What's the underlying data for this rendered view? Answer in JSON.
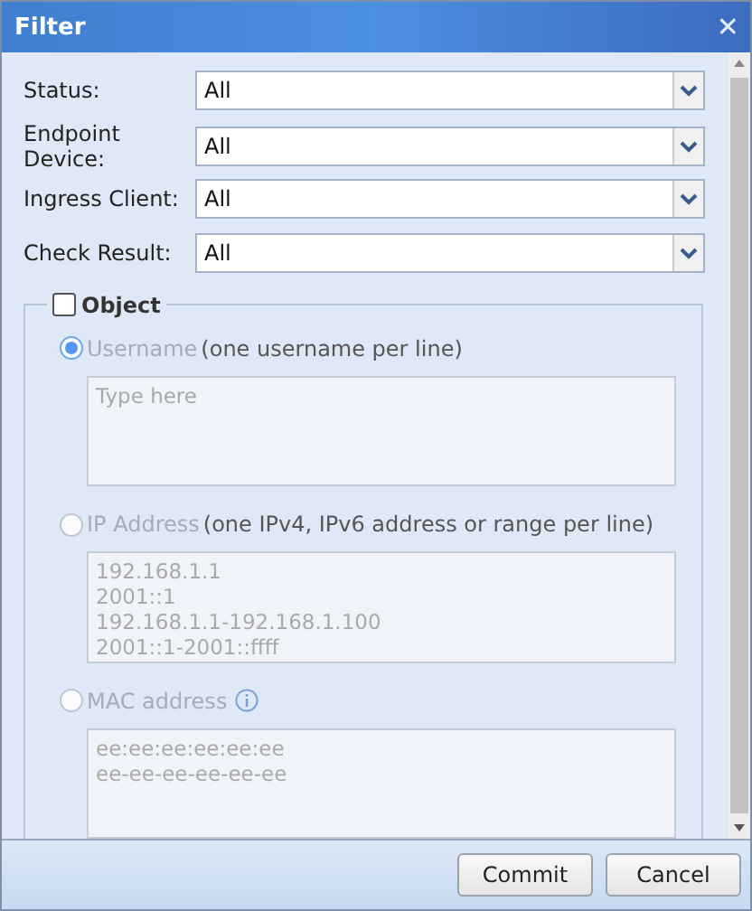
{
  "window": {
    "title": "Filter",
    "close": "✕"
  },
  "filters": [
    {
      "label": "Status:",
      "value": "All"
    },
    {
      "label": "Endpoint Device:",
      "value": "All"
    },
    {
      "label": "Ingress Client:",
      "value": "All"
    },
    {
      "label": "Check Result:",
      "value": "All"
    }
  ],
  "object": {
    "label": "Object",
    "checked": false,
    "options": [
      {
        "label": "Username",
        "hint": "(one username per line)",
        "selected": true,
        "disabled": true,
        "placeholder": "Type here"
      },
      {
        "label": "IP Address",
        "hint": "(one IPv4, IPv6 address or range per line)",
        "selected": false,
        "disabled": true,
        "placeholder": "192.168.1.1\n2001::1\n192.168.1.1-192.168.1.100\n2001::1-2001::ffff"
      },
      {
        "label": "MAC address",
        "selected": false,
        "disabled": true,
        "info": true,
        "placeholder": "ee:ee:ee:ee:ee:ee\nee-ee-ee-ee-ee-ee"
      }
    ]
  },
  "buttons": [
    "Commit",
    "Cancel"
  ]
}
